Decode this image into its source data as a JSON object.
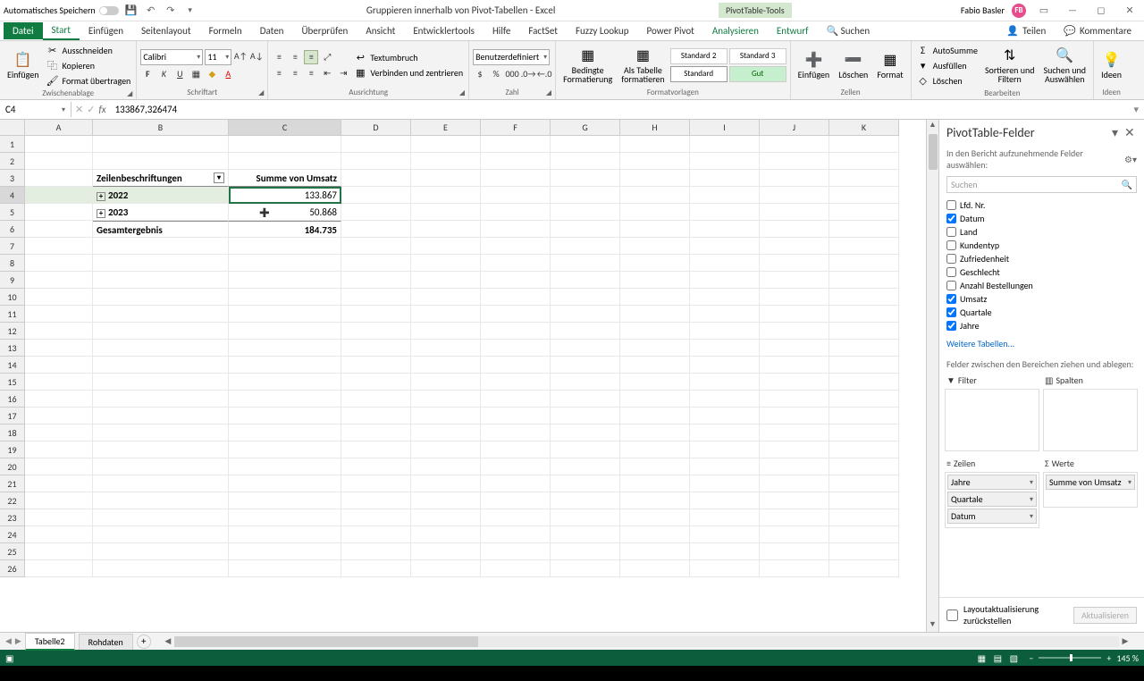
{
  "title": {
    "autosave": "Automatisches Speichern",
    "doc": "Gruppieren innerhalb von Pivot-Tabellen",
    "app": "Excel",
    "contextual": "PivotTable-Tools",
    "user": "Fabio Basler",
    "initials": "FB"
  },
  "tabs": {
    "file": "Datei",
    "items": [
      "Start",
      "Einfügen",
      "Seitenlayout",
      "Formeln",
      "Daten",
      "Überprüfen",
      "Ansicht",
      "Entwicklertools",
      "Hilfe",
      "FactSet",
      "Fuzzy Lookup",
      "Power Pivot"
    ],
    "ctx": [
      "Analysieren",
      "Entwurf"
    ],
    "search": "Suchen",
    "share": "Teilen",
    "comments": "Kommentare"
  },
  "ribbon": {
    "clipboard": {
      "paste": "Einfügen",
      "cut": "Ausschneiden",
      "copy": "Kopieren",
      "fmt": "Format übertragen",
      "label": "Zwischenablage"
    },
    "font": {
      "name": "Calibri",
      "size": "11",
      "label": "Schriftart"
    },
    "align": {
      "wrap": "Textumbruch",
      "merge": "Verbinden und zentrieren",
      "label": "Ausrichtung"
    },
    "number": {
      "format": "Benutzerdefiniert",
      "label": "Zahl"
    },
    "styles": {
      "cond": "Bedingte\nFormatierung",
      "table": "Als Tabelle\nformatieren",
      "s1": "Standard 2",
      "s2": "Standard 3",
      "s3": "Standard",
      "s4": "Gut",
      "label": "Formatvorlagen"
    },
    "cells": {
      "insert": "Einfügen",
      "delete": "Löschen",
      "format": "Format",
      "label": "Zellen"
    },
    "editing": {
      "sum": "AutoSumme",
      "fill": "Ausfüllen",
      "clear": "Löschen",
      "sort": "Sortieren und\nFiltern",
      "find": "Suchen und\nAuswählen",
      "label": "Bearbeiten"
    },
    "ideas": {
      "ideas": "Ideen",
      "label": "Ideen"
    }
  },
  "formula": {
    "name": "C4",
    "value": "133867,326474"
  },
  "cols": [
    "A",
    "B",
    "C",
    "D",
    "E",
    "F",
    "G",
    "H",
    "I",
    "J",
    "K"
  ],
  "pivot": {
    "r3b": "Zeilenbeschriftungen",
    "r3c": "Summe von Umsatz",
    "r4b": "2022",
    "r4c": "133.867",
    "r5b": "2023",
    "r5c": "50.868",
    "r6b": "Gesamtergebnis",
    "r6c": "184.735"
  },
  "pane": {
    "title": "PivotTable-Felder",
    "hint": "In den Bericht aufzunehmende Felder auswählen:",
    "search": "Suchen",
    "fields": [
      {
        "label": "Lfd. Nr.",
        "checked": false
      },
      {
        "label": "Datum",
        "checked": true
      },
      {
        "label": "Land",
        "checked": false
      },
      {
        "label": "Kundentyp",
        "checked": false
      },
      {
        "label": "Zufriedenheit",
        "checked": false
      },
      {
        "label": "Geschlecht",
        "checked": false
      },
      {
        "label": "Anzahl Bestellungen",
        "checked": false
      },
      {
        "label": "Umsatz",
        "checked": true
      },
      {
        "label": "Quartale",
        "checked": true
      },
      {
        "label": "Jahre",
        "checked": true
      }
    ],
    "more": "Weitere Tabellen...",
    "areashint": "Felder zwischen den Bereichen ziehen und ablegen:",
    "area_filter": "Filter",
    "area_cols": "Spalten",
    "area_rows": "Zeilen",
    "area_vals": "Werte",
    "row_items": [
      "Jahre",
      "Quartale",
      "Datum"
    ],
    "val_items": [
      "Summe von Umsatz"
    ],
    "defer": "Layoutaktualisierung zurückstellen",
    "update": "Aktualisieren"
  },
  "sheets": {
    "active": "Tabelle2",
    "other": "Rohdaten"
  },
  "status": {
    "zoom": "145 %"
  }
}
